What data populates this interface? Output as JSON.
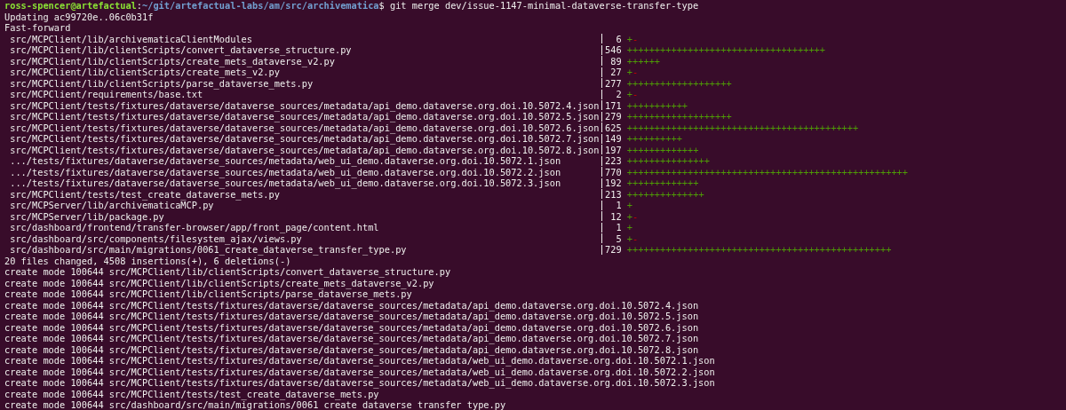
{
  "prompt": {
    "user_host": "ross-spencer@artefactual",
    "separator": ":",
    "path": "~/git/artefactual-labs/am/src/archivematica",
    "prompt_char": "$",
    "command": "git merge dev/issue-1147-minimal-dataverse-transfer-type"
  },
  "header_lines": [
    "Updating ac99720e..06c0b31f",
    "Fast-forward"
  ],
  "diffstat": [
    {
      "path": "src/MCPClient/lib/archivematicaClientModules",
      "count": "6",
      "plus": "+",
      "minus": "-"
    },
    {
      "path": "src/MCPClient/lib/clientScripts/convert_dataverse_structure.py",
      "count": "546",
      "plus": "++++++++++++++++++++++++++++++++++++"
    },
    {
      "path": "src/MCPClient/lib/clientScripts/create_mets_dataverse_v2.py",
      "count": "89",
      "plus": "++++++"
    },
    {
      "path": "src/MCPClient/lib/clientScripts/create_mets_v2.py",
      "count": "27",
      "plus": "+",
      "minus": "-"
    },
    {
      "path": "src/MCPClient/lib/clientScripts/parse_dataverse_mets.py",
      "count": "277",
      "plus": "+++++++++++++++++++"
    },
    {
      "path": "src/MCPClient/requirements/base.txt",
      "count": "2",
      "plus": "+",
      "minus": "-"
    },
    {
      "path": "src/MCPClient/tests/fixtures/dataverse/dataverse_sources/metadata/api_demo.dataverse.org.doi.10.5072.4.json",
      "count": "171",
      "plus": "+++++++++++"
    },
    {
      "path": "src/MCPClient/tests/fixtures/dataverse/dataverse_sources/metadata/api_demo.dataverse.org.doi.10.5072.5.json",
      "count": "279",
      "plus": "+++++++++++++++++++"
    },
    {
      "path": "src/MCPClient/tests/fixtures/dataverse/dataverse_sources/metadata/api_demo.dataverse.org.doi.10.5072.6.json",
      "count": "625",
      "plus": "++++++++++++++++++++++++++++++++++++++++++"
    },
    {
      "path": "src/MCPClient/tests/fixtures/dataverse/dataverse_sources/metadata/api_demo.dataverse.org.doi.10.5072.7.json",
      "count": "149",
      "plus": "++++++++++"
    },
    {
      "path": "src/MCPClient/tests/fixtures/dataverse/dataverse_sources/metadata/api_demo.dataverse.org.doi.10.5072.8.json",
      "count": "197",
      "plus": "+++++++++++++"
    },
    {
      "path": ".../tests/fixtures/dataverse/dataverse_sources/metadata/web_ui_demo.dataverse.org.doi.10.5072.1.json",
      "count": "223",
      "plus": "+++++++++++++++"
    },
    {
      "path": ".../tests/fixtures/dataverse/dataverse_sources/metadata/web_ui_demo.dataverse.org.doi.10.5072.2.json",
      "count": "770",
      "plus": "+++++++++++++++++++++++++++++++++++++++++++++++++++"
    },
    {
      "path": ".../tests/fixtures/dataverse/dataverse_sources/metadata/web_ui_demo.dataverse.org.doi.10.5072.3.json",
      "count": "192",
      "plus": "+++++++++++++"
    },
    {
      "path": "src/MCPClient/tests/test_create_dataverse_mets.py",
      "count": "213",
      "plus": "++++++++++++++"
    },
    {
      "path": "src/MCPServer/lib/archivematicaMCP.py",
      "count": "1",
      "plus": "+"
    },
    {
      "path": "src/MCPServer/lib/package.py",
      "count": "12",
      "plus": "+",
      "minus": "-"
    },
    {
      "path": "src/dashboard/frontend/transfer-browser/app/front_page/content.html",
      "count": "1",
      "plus": "+"
    },
    {
      "path": "src/dashboard/src/components/filesystem_ajax/views.py",
      "count": "5",
      "plus": "+",
      "minus": "-"
    },
    {
      "path": "src/dashboard/src/main/migrations/0061_create_dataverse_transfer_type.py",
      "count": "729",
      "plus": "++++++++++++++++++++++++++++++++++++++++++++++++"
    }
  ],
  "summary": "20 files changed, 4508 insertions(+), 6 deletions(-)",
  "create_lines": [
    "create mode 100644 src/MCPClient/lib/clientScripts/convert_dataverse_structure.py",
    "create mode 100644 src/MCPClient/lib/clientScripts/create_mets_dataverse_v2.py",
    "create mode 100644 src/MCPClient/lib/clientScripts/parse_dataverse_mets.py",
    "create mode 100644 src/MCPClient/tests/fixtures/dataverse/dataverse_sources/metadata/api_demo.dataverse.org.doi.10.5072.4.json",
    "create mode 100644 src/MCPClient/tests/fixtures/dataverse/dataverse_sources/metadata/api_demo.dataverse.org.doi.10.5072.5.json",
    "create mode 100644 src/MCPClient/tests/fixtures/dataverse/dataverse_sources/metadata/api_demo.dataverse.org.doi.10.5072.6.json",
    "create mode 100644 src/MCPClient/tests/fixtures/dataverse/dataverse_sources/metadata/api_demo.dataverse.org.doi.10.5072.7.json",
    "create mode 100644 src/MCPClient/tests/fixtures/dataverse/dataverse_sources/metadata/api_demo.dataverse.org.doi.10.5072.8.json",
    "create mode 100644 src/MCPClient/tests/fixtures/dataverse/dataverse_sources/metadata/web_ui_demo.dataverse.org.doi.10.5072.1.json",
    "create mode 100644 src/MCPClient/tests/fixtures/dataverse/dataverse_sources/metadata/web_ui_demo.dataverse.org.doi.10.5072.2.json",
    "create mode 100644 src/MCPClient/tests/fixtures/dataverse/dataverse_sources/metadata/web_ui_demo.dataverse.org.doi.10.5072.3.json",
    "create mode 100644 src/MCPClient/tests/test_create_dataverse_mets.py",
    "create mode 100644 src/dashboard/src/main/migrations/0061_create_dataverse_transfer_type.py"
  ]
}
